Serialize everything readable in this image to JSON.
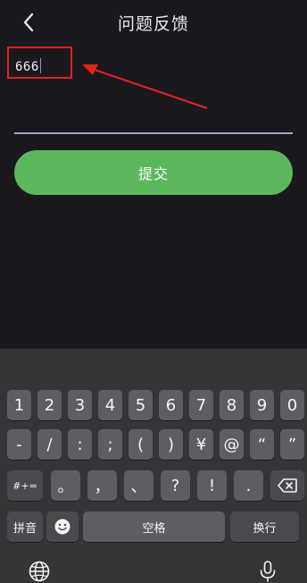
{
  "header": {
    "title": "问题反馈",
    "back_icon": "chevron-left-icon"
  },
  "feedback": {
    "value": "666"
  },
  "submit": {
    "label": "提交",
    "color": "#5cb85c"
  },
  "annotation": {
    "color": "#e0231b"
  },
  "keyboard": {
    "row1": [
      "1",
      "2",
      "3",
      "4",
      "5",
      "6",
      "7",
      "8",
      "9",
      "0"
    ],
    "row2": [
      "-",
      "/",
      ":",
      ";",
      "(",
      ")",
      "¥",
      "@",
      "“",
      "”"
    ],
    "row3": [
      "#+=",
      "。",
      "，",
      "、",
      "?",
      "!",
      ".",
      "delete-icon"
    ],
    "row4": [
      "拼音",
      "emoji-icon",
      "空格",
      "换行"
    ],
    "bottom_icons": [
      "globe-icon",
      "microphone-icon"
    ]
  }
}
